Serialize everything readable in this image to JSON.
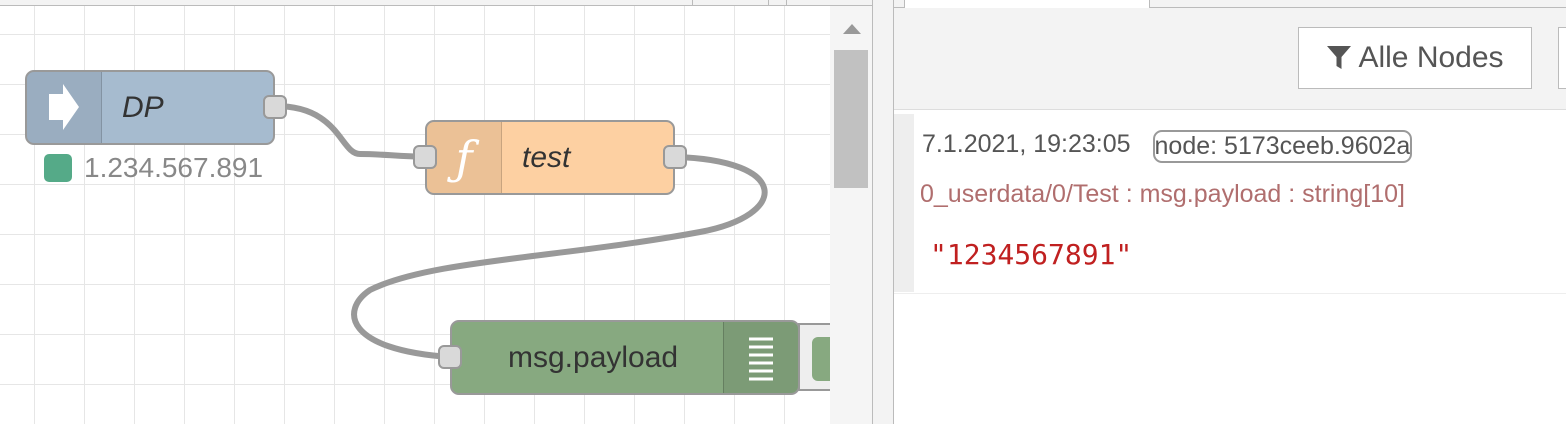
{
  "workspace": {
    "nodes": {
      "dp": {
        "label": "DP",
        "icon": "arrow-right-icon",
        "status": "1.234.567.891",
        "status_color": "#55aa88"
      },
      "test": {
        "label": "test",
        "icon": "function-icon",
        "icon_glyph": "ƒ"
      },
      "debug": {
        "label": "msg.payload",
        "icon": "list-icon"
      }
    },
    "colors": {
      "inject": "#a6bbcf",
      "function": "#fdd0a2",
      "debug": "#87a980"
    }
  },
  "sidebar": {
    "filter_button": {
      "label": "Alle Nodes",
      "icon": "filter-icon"
    },
    "message": {
      "timestamp": "7.1.2021, 19:23:05",
      "node": "node: 5173ceeb.9602a",
      "topic": "0_userdata/0/Test : msg.payload : string[10]",
      "value": "\"1234567891\""
    }
  }
}
